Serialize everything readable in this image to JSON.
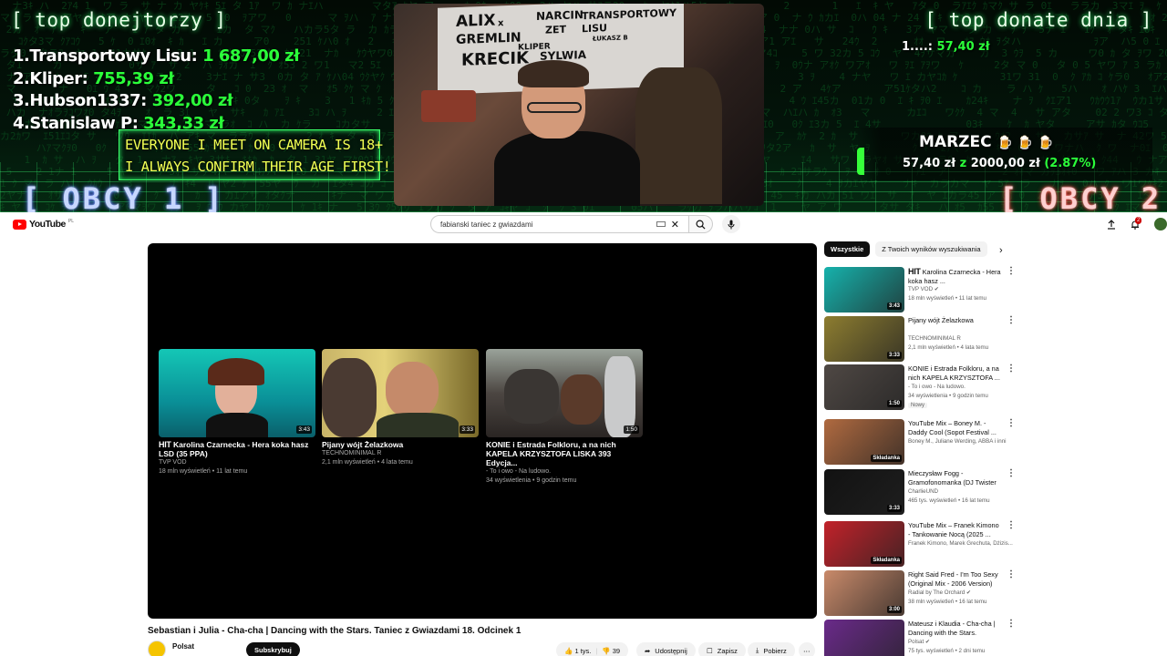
{
  "overlay": {
    "top_donors_title": "[ top donejtorzy ]",
    "top_donors": [
      {
        "rank": "1.",
        "name": "Transportowy Lisu:",
        "amount": "1 687,00 zł"
      },
      {
        "rank": "2.",
        "name": "Kliper:",
        "amount": "755,39 zł"
      },
      {
        "rank": "3.",
        "name": "Hubson1337:",
        "amount": "392,00 zł"
      },
      {
        "rank": "4.",
        "name": "Stanislaw P:",
        "amount": "343,33 zł"
      }
    ],
    "top_day_title": "[ top donate dnia ]",
    "top_day": {
      "rank": "1.",
      "name": "...:",
      "amount": "57,40 zł"
    },
    "disclaimer_line1": "EVERYONE I MEET ON CAMERA IS 18+",
    "disclaimer_line2": "I ALWAYS CONFIRM THEIR AGE FIRST!",
    "goal": {
      "name": "MARZEC",
      "icons": "🍺 🍺 🍺",
      "current": "57,40 zł",
      "sep": "z",
      "target": "2000,00 zł",
      "percent": "(2.87%)",
      "progress": 0.0287
    },
    "obcy_left": "[ OBCY 1 ]",
    "obcy_right": "[ OBCY 2 ]",
    "board": {
      "w1": "ALIX",
      "w2": "NARCIN",
      "w3": "TRANSPORTOWY",
      "w4": "GREMLIN",
      "w5": "ZET",
      "w6": "LISU",
      "w7": "KRECIK",
      "w8": "KLIPER",
      "w9": "SYLWIA",
      "w10": "ŁUKASZ B",
      "w11": "x"
    }
  },
  "youtube": {
    "logo_text": "YouTube",
    "logo_country": "PL",
    "search_value": "fabianski taniec z gwiazdami",
    "notif_count": "2",
    "endcards": [
      {
        "title": "Karolina Czarnecka - Hera koka hasz LSD (35 PPA)",
        "brand": "HIT",
        "channel": "TVP VOD",
        "meta": "18 mln wyświetleń • 11 lat temu",
        "duration": "3:43",
        "color": "#0fa6a0"
      },
      {
        "title": "Pijany wójt Żelazkowa",
        "channel": "TECHNOMINIMAL R",
        "meta": "2,1 mln wyświetleń • 4 lata temu",
        "duration": "3:33",
        "color": "#8a7a2a"
      },
      {
        "title": "KONIE i Estrada Folkloru, a na nich KAPELA KRZYSZTOFA LISKA 393 Edycja...",
        "channel": "- To i owo - Na ludowo.",
        "meta": "34 wyświetlenia • 9 godzin temu",
        "duration": "1:50",
        "color": "#4a4340"
      }
    ],
    "video_title": "Sebastian i Julia - Cha-cha | Dancing with the Stars. Taniec z Gwiazdami 18. Odcinek 1",
    "channel": "Polsat",
    "subscribe": "Subskrybuj",
    "likes": "1 tys.",
    "dislikes": "39",
    "share": "Udostępnij",
    "save": "Zapisz",
    "download": "Pobierz",
    "chips": [
      "Wszystkie",
      "Z Twoich wyników wyszukiwania"
    ],
    "recs": [
      {
        "title": "Karolina Czarnecka - Hera koka hasz ...",
        "brand": "HIT",
        "channel": "TVP VOD",
        "verified": true,
        "meta": "18 mln wyświetleń • 11 lat temu",
        "duration": "3:43",
        "color": "#16b2ac",
        "new": ""
      },
      {
        "title": "Pijany wójt Żelazkowa",
        "channel": "TECHNOMINIMAL R",
        "verified": false,
        "meta": "2,1 mln wyświetleń • 4 lata temu",
        "duration": "3:33",
        "color": "#8d7d30",
        "new": ""
      },
      {
        "title": "KONIE i Estrada Folkloru, a na nich KAPELA KRZYSZTOFA ...",
        "channel": "- To i owo - Na ludowo.",
        "verified": false,
        "meta": "34 wyświetlenia • 9 godzin temu",
        "duration": "1:50",
        "color": "#4f4844",
        "new": "Nowy"
      },
      {
        "title": "YouTube Mix – Boney M. - Daddy Cool (Sopot Festival ...",
        "channel": "Boney M., Juliane Werding, ABBA i inni",
        "verified": false,
        "meta": "",
        "duration": "Składanka",
        "color": "#b06a40",
        "new": ""
      },
      {
        "title": "Mieczysław Fogg - Gramofonomanka (DJ Twister ...",
        "channel": "CharlieUND",
        "verified": false,
        "meta": "465 tys. wyświetleń • 16 lat temu",
        "duration": "3:33",
        "color": "#121212",
        "new": ""
      },
      {
        "title": "YouTube Mix – Franek Kimono - Tankowanie Nocą (2025 ...",
        "channel": "Franek Kimono, Marek Grechuta, Dżizis...",
        "verified": false,
        "meta": "",
        "duration": "Składanka",
        "color": "#c2222a",
        "new": ""
      },
      {
        "title": "Right Said Fred - I'm Too Sexy (Original Mix - 2006 Version)",
        "channel": "Radial by The Orchard",
        "verified": true,
        "meta": "38 mln wyświetleń • 16 lat temu",
        "duration": "3:00",
        "color": "#c98a6a",
        "new": ""
      },
      {
        "title": "Mateusz i Klaudia - Cha-cha | Dancing with the Stars. Taniec...",
        "channel": "Polsat",
        "verified": true,
        "meta": "75 tys. wyświetleń • 2 dni temu",
        "duration": "",
        "color": "#6a2a8a",
        "new": ""
      }
    ]
  }
}
